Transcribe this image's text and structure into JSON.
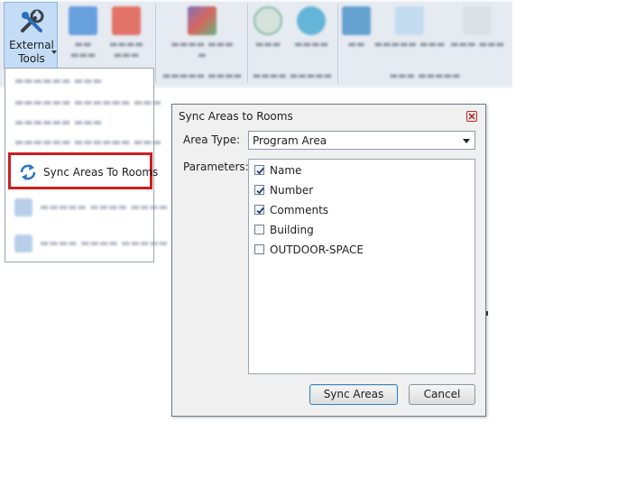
{
  "ribbon": {
    "external_tools": {
      "label_line1": "External",
      "label_line2": "Tools"
    },
    "colors": {
      "accent": "#c4dcf5",
      "highlight": "#cc1f1f"
    }
  },
  "dropdown": {
    "highlighted_item": {
      "label": "Sync Areas To Rooms",
      "icon": "sync-arrows-icon"
    }
  },
  "dialog": {
    "title": "Sync Areas to Rooms",
    "area_type_label": "Area Type:",
    "area_type_value": "Program Area",
    "parameters_label": "Parameters:",
    "parameters": [
      {
        "label": "Name",
        "checked": true
      },
      {
        "label": "Number",
        "checked": true
      },
      {
        "label": "Comments",
        "checked": true
      },
      {
        "label": "Building",
        "checked": false
      },
      {
        "label": "OUTDOOR-SPACE",
        "checked": false
      }
    ],
    "sync_button": "Sync Areas",
    "cancel_button": "Cancel"
  }
}
